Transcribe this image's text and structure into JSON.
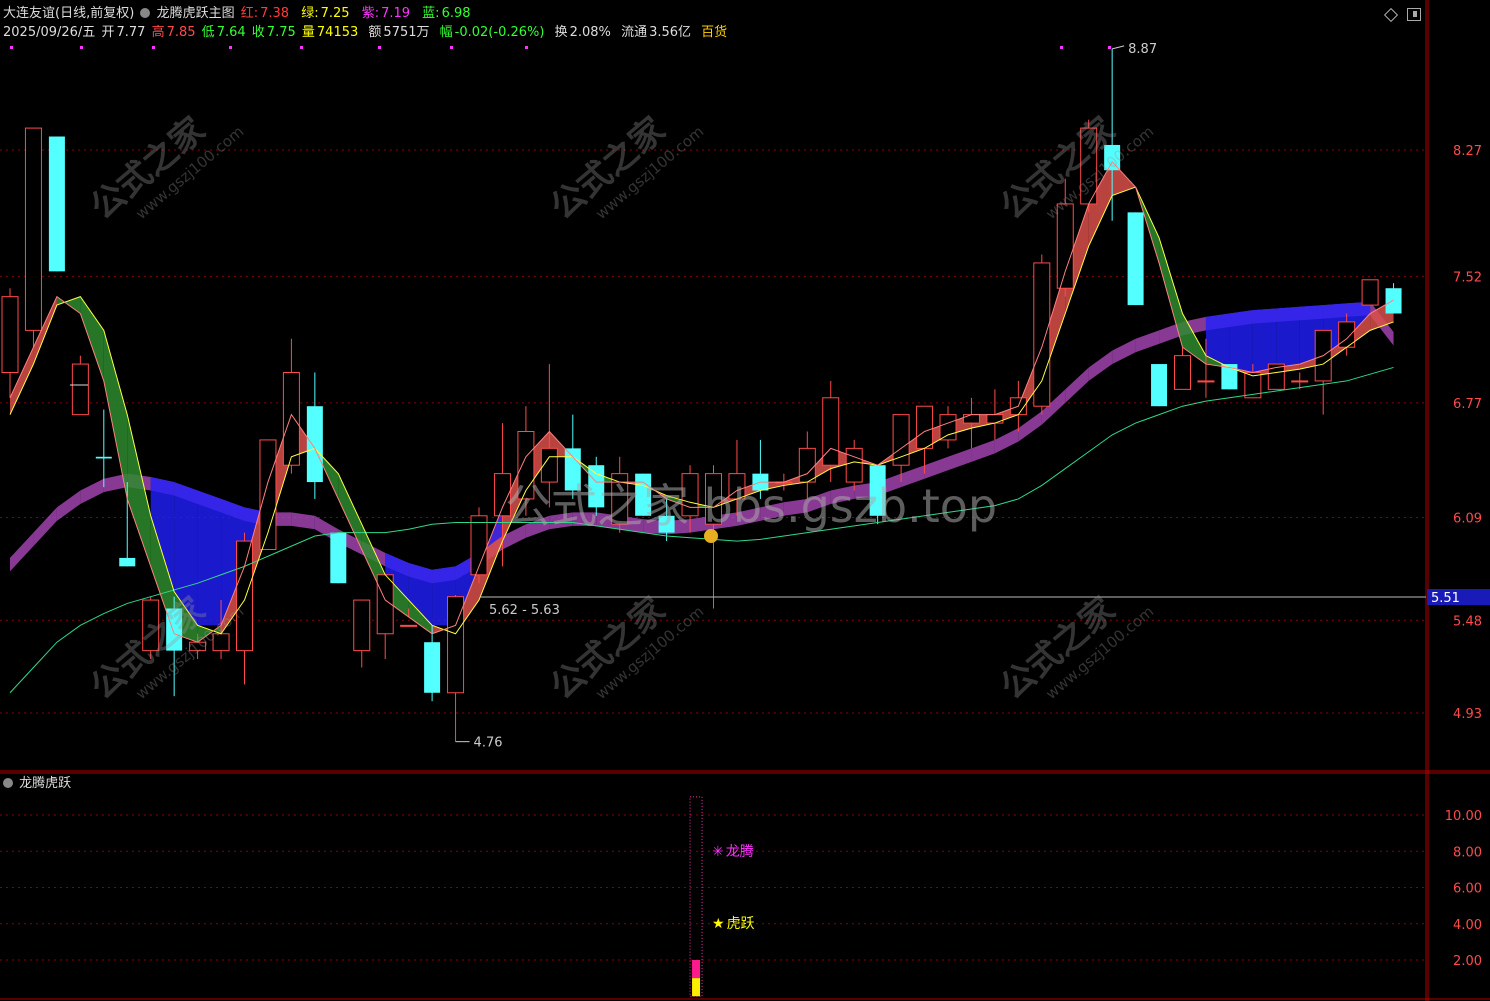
{
  "header": {
    "stock_title": "大连友谊(日线,前复权)",
    "indicator_title": "龙腾虎跃主图",
    "lines": [
      {
        "label": "红:",
        "value": "7.38",
        "color": "#ff3b3b"
      },
      {
        "label": "绿:",
        "value": "7.25",
        "color": "#ffff00"
      },
      {
        "label": "紫:",
        "value": "7.19",
        "color": "#ff33ff"
      },
      {
        "label": "蓝:",
        "value": "6.98",
        "color": "#33ff33"
      }
    ],
    "date": "2025/09/26/五",
    "open_label": "开",
    "open": "7.77",
    "high_label": "高",
    "high": "7.85",
    "low_label": "低",
    "low": "7.64",
    "close_label": "收",
    "close": "7.75",
    "volume_label": "量",
    "volume": "74153",
    "amount_label": "额",
    "amount": "5751万",
    "change_label": "幅",
    "change": "-0.02(-0.26%)",
    "turnover_label": "换",
    "turnover": "2.08%",
    "float_label": "流通",
    "float_cap": "3.56亿",
    "sector": "百货"
  },
  "sub_panel": {
    "title": "龙腾虎跃",
    "signal_dragon": "龙腾",
    "signal_tiger": "虎跃"
  },
  "watermark": {
    "site_cn": "公式之家",
    "site_url": "www.gszj100.com",
    "center": "公式之家 bbs.gszb.top"
  },
  "colors": {
    "up": "#ff4a4a",
    "down": "#54ffff",
    "grid": "#8b0000",
    "red_band": "#d9504a",
    "green_band": "#2e8b2e",
    "purple_band": "#b44cc4",
    "blue_band": "#2020ff"
  },
  "chart_data": [
    {
      "type": "candlestick",
      "y_ticks": [
        "8.27",
        "7.52",
        "6.77",
        "6.09",
        "5.48",
        "4.93"
      ],
      "current_price_label": "5.51",
      "annotations": {
        "high": "8.87",
        "low": "4.76",
        "range": "5.62 - 5.63"
      },
      "candles": [
        {
          "o": 6.95,
          "h": 7.45,
          "l": 6.8,
          "c": 7.4
        },
        {
          "o": 7.2,
          "h": 8.4,
          "l": 7.1,
          "c": 8.4
        },
        {
          "o": 8.35,
          "h": 8.35,
          "l": 7.55,
          "c": 7.55
        },
        {
          "o": 6.7,
          "h": 7.05,
          "l": 6.7,
          "c": 7.0
        },
        {
          "o": 6.45,
          "h": 6.73,
          "l": 6.27,
          "c": 6.44
        },
        {
          "o": 5.85,
          "h": 6.3,
          "l": 5.8,
          "c": 5.8
        },
        {
          "o": 5.3,
          "h": 5.62,
          "l": 5.25,
          "c": 5.6
        },
        {
          "o": 5.55,
          "h": 5.62,
          "l": 5.03,
          "c": 5.3
        },
        {
          "o": 5.3,
          "h": 5.4,
          "l": 5.25,
          "c": 5.35
        },
        {
          "o": 5.3,
          "h": 5.6,
          "l": 5.25,
          "c": 5.4
        },
        {
          "o": 5.3,
          "h": 6.0,
          "l": 5.1,
          "c": 5.95
        },
        {
          "o": 5.9,
          "h": 6.55,
          "l": 5.9,
          "c": 6.55
        },
        {
          "o": 6.4,
          "h": 7.15,
          "l": 6.35,
          "c": 6.95
        },
        {
          "o": 6.75,
          "h": 6.95,
          "l": 6.2,
          "c": 6.3
        },
        {
          "o": 6.0,
          "h": 6.0,
          "l": 5.7,
          "c": 5.7
        },
        {
          "o": 5.3,
          "h": 5.6,
          "l": 5.2,
          "c": 5.6
        },
        {
          "o": 5.4,
          "h": 5.7,
          "l": 5.25,
          "c": 5.75
        },
        {
          "o": 5.45,
          "h": 5.55,
          "l": 5.5,
          "c": 5.45
        },
        {
          "o": 5.35,
          "h": 5.45,
          "l": 5.0,
          "c": 5.05
        },
        {
          "o": 5.05,
          "h": 5.63,
          "l": 4.76,
          "c": 5.62
        },
        {
          "o": 5.75,
          "h": 6.15,
          "l": 5.7,
          "c": 6.1
        },
        {
          "o": 6.1,
          "h": 6.65,
          "l": 5.8,
          "c": 6.35
        },
        {
          "o": 6.2,
          "h": 6.75,
          "l": 6.1,
          "c": 6.6
        },
        {
          "o": 6.3,
          "h": 7.0,
          "l": 6.15,
          "c": 6.5
        },
        {
          "o": 6.5,
          "h": 6.7,
          "l": 6.2,
          "c": 6.25
        },
        {
          "o": 6.4,
          "h": 6.45,
          "l": 6.1,
          "c": 6.15
        },
        {
          "o": 6.05,
          "h": 6.45,
          "l": 6.0,
          "c": 6.35
        },
        {
          "o": 6.35,
          "h": 6.35,
          "l": 6.1,
          "c": 6.1
        },
        {
          "o": 6.1,
          "h": 6.2,
          "l": 5.95,
          "c": 6.0
        },
        {
          "o": 6.1,
          "h": 6.4,
          "l": 6.0,
          "c": 6.35
        },
        {
          "o": 6.05,
          "h": 6.4,
          "l": 5.55,
          "c": 6.35
        },
        {
          "o": 6.2,
          "h": 6.55,
          "l": 6.1,
          "c": 6.35
        },
        {
          "o": 6.35,
          "h": 6.55,
          "l": 6.2,
          "c": 6.25
        },
        {
          "o": 6.3,
          "h": 6.35,
          "l": 6.25,
          "c": 6.3
        },
        {
          "o": 6.3,
          "h": 6.6,
          "l": 6.2,
          "c": 6.5
        },
        {
          "o": 6.4,
          "h": 6.9,
          "l": 6.3,
          "c": 6.8
        },
        {
          "o": 6.3,
          "h": 6.55,
          "l": 6.25,
          "c": 6.5
        },
        {
          "o": 6.4,
          "h": 6.4,
          "l": 6.05,
          "c": 6.1
        },
        {
          "o": 6.4,
          "h": 6.7,
          "l": 6.3,
          "c": 6.7
        },
        {
          "o": 6.5,
          "h": 6.75,
          "l": 6.35,
          "c": 6.75
        },
        {
          "o": 6.55,
          "h": 6.75,
          "l": 6.5,
          "c": 6.7
        },
        {
          "o": 6.65,
          "h": 6.8,
          "l": 6.5,
          "c": 6.7
        },
        {
          "o": 6.65,
          "h": 6.85,
          "l": 6.55,
          "c": 6.7
        },
        {
          "o": 6.7,
          "h": 6.9,
          "l": 6.6,
          "c": 6.8
        },
        {
          "o": 6.75,
          "h": 7.65,
          "l": 6.7,
          "c": 7.6
        },
        {
          "o": 7.45,
          "h": 8.1,
          "l": 7.4,
          "c": 7.95
        },
        {
          "o": 7.95,
          "h": 8.45,
          "l": 7.9,
          "c": 8.4
        },
        {
          "o": 8.3,
          "h": 8.87,
          "l": 7.85,
          "c": 8.15
        },
        {
          "o": 7.9,
          "h": 7.9,
          "l": 7.35,
          "c": 7.35
        },
        {
          "o": 7.0,
          "h": 7.0,
          "l": 6.75,
          "c": 6.75
        },
        {
          "o": 6.85,
          "h": 7.1,
          "l": 6.85,
          "c": 7.05
        },
        {
          "o": 6.9,
          "h": 7.15,
          "l": 6.8,
          "c": 6.9
        },
        {
          "o": 7.0,
          "h": 7.0,
          "l": 6.85,
          "c": 6.85
        },
        {
          "o": 6.8,
          "h": 7.0,
          "l": 6.8,
          "c": 6.95
        },
        {
          "o": 6.85,
          "h": 7.0,
          "l": 6.85,
          "c": 7.0
        },
        {
          "o": 6.9,
          "h": 6.95,
          "l": 6.85,
          "c": 6.9
        },
        {
          "o": 6.9,
          "h": 7.2,
          "l": 6.7,
          "c": 7.2
        },
        {
          "o": 7.1,
          "h": 7.3,
          "l": 7.05,
          "c": 7.25
        },
        {
          "o": 7.35,
          "h": 7.5,
          "l": 7.35,
          "c": 7.5
        },
        {
          "o": 7.45,
          "h": 7.48,
          "l": 7.3,
          "c": 7.3
        }
      ],
      "red_line": [
        6.8,
        7.1,
        7.4,
        7.3,
        6.9,
        6.2,
        5.8,
        5.4,
        5.35,
        5.45,
        5.8,
        6.3,
        6.7,
        6.5,
        6.2,
        5.9,
        5.6,
        5.5,
        5.4,
        5.45,
        5.8,
        6.15,
        6.45,
        6.6,
        6.45,
        6.3,
        6.3,
        6.3,
        6.2,
        6.15,
        6.15,
        6.25,
        6.3,
        6.3,
        6.35,
        6.5,
        6.45,
        6.4,
        6.5,
        6.6,
        6.65,
        6.7,
        6.7,
        6.75,
        7.1,
        7.55,
        7.95,
        8.2,
        8.05,
        7.6,
        7.1,
        7.0,
        6.98,
        6.95,
        6.98,
        7.0,
        7.05,
        7.15,
        7.3,
        7.38
      ],
      "yellow_line": [
        6.7,
        7.0,
        7.35,
        7.4,
        7.2,
        6.7,
        6.1,
        5.65,
        5.45,
        5.4,
        5.6,
        6.0,
        6.45,
        6.5,
        6.35,
        6.05,
        5.75,
        5.6,
        5.45,
        5.4,
        5.6,
        5.95,
        6.25,
        6.45,
        6.45,
        6.35,
        6.3,
        6.28,
        6.22,
        6.18,
        6.15,
        6.2,
        6.25,
        6.28,
        6.3,
        6.38,
        6.42,
        6.4,
        6.45,
        6.5,
        6.58,
        6.62,
        6.65,
        6.7,
        6.9,
        7.3,
        7.7,
        8.0,
        8.05,
        7.75,
        7.3,
        7.05,
        6.98,
        6.93,
        6.95,
        6.97,
        7.0,
        7.1,
        7.2,
        7.25
      ],
      "purple_line": [
        5.85,
        6.0,
        6.15,
        6.25,
        6.32,
        6.35,
        6.33,
        6.3,
        6.25,
        6.2,
        6.15,
        6.12,
        6.12,
        6.1,
        6.02,
        5.95,
        5.88,
        5.82,
        5.78,
        5.8,
        5.88,
        5.98,
        6.05,
        6.1,
        6.12,
        6.12,
        6.1,
        6.08,
        6.07,
        6.08,
        6.1,
        6.12,
        6.15,
        6.18,
        6.2,
        6.25,
        6.28,
        6.3,
        6.35,
        6.4,
        6.45,
        6.5,
        6.55,
        6.62,
        6.72,
        6.85,
        6.98,
        7.08,
        7.15,
        7.2,
        7.25,
        7.28,
        7.3,
        7.32,
        7.33,
        7.34,
        7.35,
        7.36,
        7.37,
        7.19
      ],
      "green_line": [
        5.05,
        5.2,
        5.35,
        5.45,
        5.52,
        5.58,
        5.62,
        5.66,
        5.7,
        5.75,
        5.8,
        5.86,
        5.92,
        5.98,
        6.0,
        6.0,
        6.0,
        6.02,
        6.05,
        6.06,
        6.06,
        6.06,
        6.06,
        6.06,
        6.06,
        6.04,
        6.02,
        6.0,
        5.98,
        5.97,
        5.96,
        5.95,
        5.96,
        5.98,
        6.0,
        6.02,
        6.04,
        6.06,
        6.08,
        6.1,
        6.12,
        6.14,
        6.16,
        6.2,
        6.28,
        6.38,
        6.48,
        6.58,
        6.65,
        6.7,
        6.75,
        6.78,
        6.8,
        6.82,
        6.84,
        6.86,
        6.88,
        6.9,
        6.94,
        6.98
      ]
    },
    {
      "type": "bar",
      "y_ticks": [
        "10.00",
        "8.00",
        "6.00",
        "4.00",
        "2.00"
      ],
      "signal_bar": {
        "index": 29,
        "value": 11,
        "magenta_top": 2,
        "yellow_top": 1
      }
    }
  ]
}
